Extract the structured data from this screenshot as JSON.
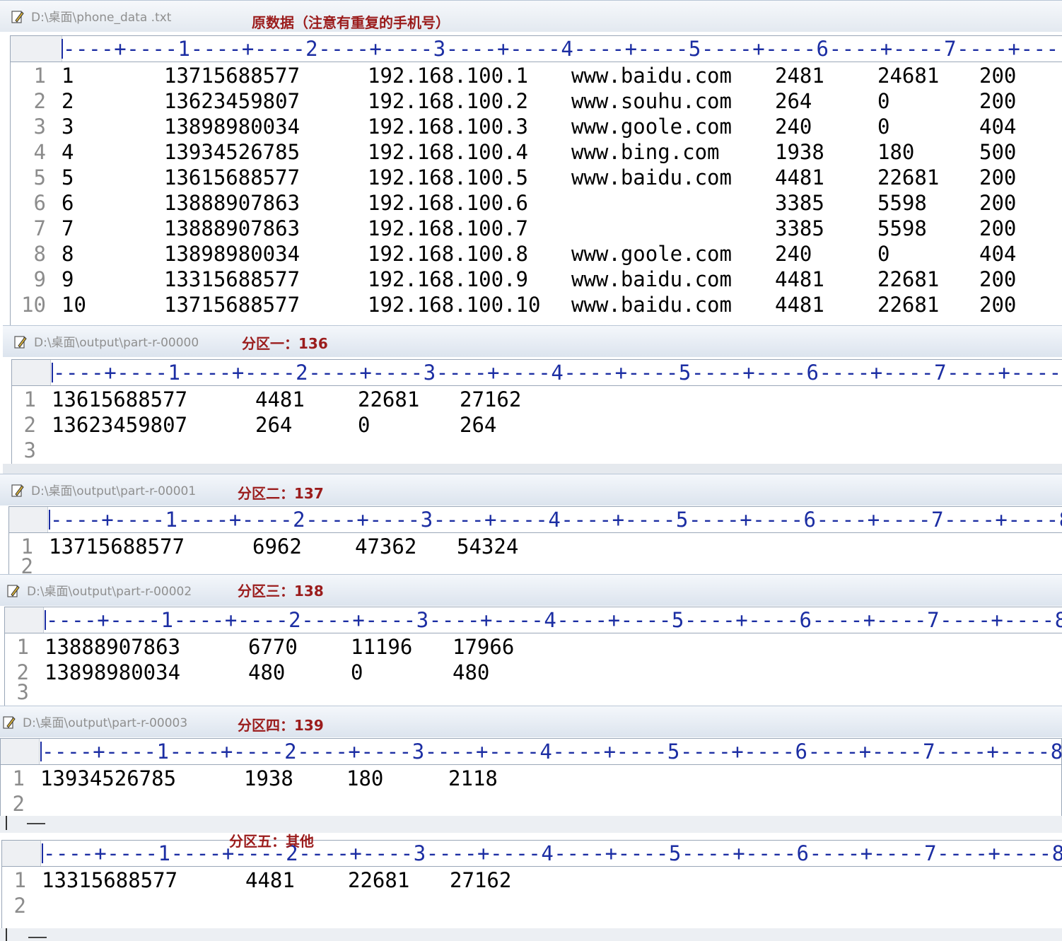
{
  "ruler_text": "----+----1----+----2----+----3----+----4----+----5----+----6----+----7----+----8",
  "panels": [
    {
      "path": "D:\\桌面\\phone_data .txt",
      "annotation": "原数据（注意有重复的手机号）",
      "rows": [
        {
          "n": "1",
          "cells": [
            "1",
            "13715688577",
            "192.168.100.1",
            "www.baidu.com",
            "2481",
            "24681",
            "200"
          ]
        },
        {
          "n": "2",
          "cells": [
            "2",
            "13623459807",
            "192.168.100.2",
            "www.souhu.com",
            "264",
            "0",
            "200"
          ]
        },
        {
          "n": "3",
          "cells": [
            "3",
            "13898980034",
            "192.168.100.3",
            "www.goole.com",
            "240",
            "0",
            "404"
          ]
        },
        {
          "n": "4",
          "cells": [
            "4",
            "13934526785",
            "192.168.100.4",
            "www.bing.com",
            "1938",
            "180",
            "500"
          ]
        },
        {
          "n": "5",
          "cells": [
            "5",
            "13615688577",
            "192.168.100.5",
            "www.baidu.com",
            "4481",
            "22681",
            "200"
          ]
        },
        {
          "n": "6",
          "cells": [
            "6",
            "13888907863",
            "192.168.100.6",
            "",
            "3385",
            "5598",
            "200"
          ]
        },
        {
          "n": "7",
          "cells": [
            "7",
            "13888907863",
            "192.168.100.7",
            "",
            "3385",
            "5598",
            "200"
          ]
        },
        {
          "n": "8",
          "cells": [
            "8",
            "13898980034",
            "192.168.100.8",
            "www.goole.com",
            "240",
            "0",
            "404"
          ]
        },
        {
          "n": "9",
          "cells": [
            "9",
            "13315688577",
            "192.168.100.9",
            "www.baidu.com",
            "4481",
            "22681",
            "200"
          ]
        },
        {
          "n": "10",
          "cells": [
            "10",
            "13715688577",
            "192.168.100.10",
            "www.baidu.com",
            "4481",
            "22681",
            "200"
          ]
        }
      ]
    },
    {
      "path": "D:\\桌面\\output\\part-r-00000",
      "annotation": "分区一：136",
      "rows": [
        {
          "n": "1",
          "cells": [
            "13615688577",
            "4481",
            "22681",
            "27162"
          ]
        },
        {
          "n": "2",
          "cells": [
            "13623459807",
            "264",
            "0",
            "264"
          ]
        },
        {
          "n": "3",
          "cells": []
        }
      ]
    },
    {
      "path": "D:\\桌面\\output\\part-r-00001",
      "annotation": "分区二：137",
      "rows": [
        {
          "n": "1",
          "cells": [
            "13715688577",
            "6962",
            "47362",
            "54324"
          ]
        },
        {
          "n": "2",
          "cells": []
        }
      ]
    },
    {
      "path": "D:\\桌面\\output\\part-r-00002",
      "annotation": "分区三：138",
      "rows": [
        {
          "n": "1",
          "cells": [
            "13888907863",
            "6770",
            "11196",
            "17966"
          ]
        },
        {
          "n": "2",
          "cells": [
            "13898980034",
            "480",
            "0",
            "480"
          ]
        },
        {
          "n": "3",
          "cells": []
        }
      ]
    },
    {
      "path": "D:\\桌面\\output\\part-r-00003",
      "annotation": "分区四：139",
      "rows": [
        {
          "n": "1",
          "cells": [
            "13934526785",
            "1938",
            "180",
            "2118"
          ]
        },
        {
          "n": "2",
          "cells": []
        }
      ]
    },
    {
      "path": "",
      "annotation": "分区五：其他",
      "rows": [
        {
          "n": "1",
          "cells": [
            "13315688577",
            "4481",
            "22681",
            "27162"
          ]
        },
        {
          "n": "2",
          "cells": []
        }
      ]
    }
  ]
}
